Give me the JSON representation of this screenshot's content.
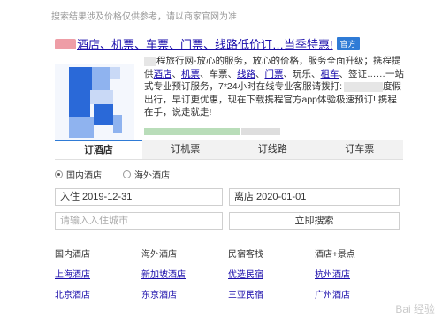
{
  "disclaimer": "搜索结果涉及价格仅供参考，请以商家官网为准",
  "result": {
    "title": "酒店、机票、车票、门票、线路低价订…当季特惠!",
    "official_badge": "官方",
    "description": {
      "part1": "程旅行网-放心的服务，放心的价格，服务全面升级；携程提供",
      "links": [
        "酒店",
        "机票",
        "线路",
        "门票",
        "租车"
      ],
      "sep_car": "、车票、",
      "sep_play": "、玩乐、",
      "sep_visa": "、签证……一站式专业预订服务，7*24小时在线专业客服请拨打:",
      "part2": "度假出行，早订更优惠，现在下载携程官方app体验极速预订! 携程在手，说走就走!",
      "comma": "、"
    },
    "logo_colors": [
      "#2a69d8",
      "#8fb3ef",
      "#c9d9f6"
    ]
  },
  "tabs": [
    {
      "label": "订酒店",
      "active": true
    },
    {
      "label": "订机票",
      "active": false
    },
    {
      "label": "订线路",
      "active": false
    },
    {
      "label": "订车票",
      "active": false
    }
  ],
  "radio": {
    "domestic": "国内酒店",
    "overseas": "海外酒店"
  },
  "form": {
    "checkin": "入住 2019-12-31",
    "checkout": "离店 2020-01-01",
    "city_placeholder": "请输入入住城市",
    "search": "立即搜索"
  },
  "links": {
    "headers": [
      "国内酒店",
      "海外酒店",
      "民宿客栈",
      "酒店+景点"
    ],
    "rows": [
      [
        "上海酒店",
        "新加坡酒店",
        "优选民宿",
        "杭州酒店"
      ],
      [
        "北京酒店",
        "东京酒店",
        "三亚民宿",
        "广州酒店"
      ]
    ]
  },
  "watermark": "Bai 经验"
}
